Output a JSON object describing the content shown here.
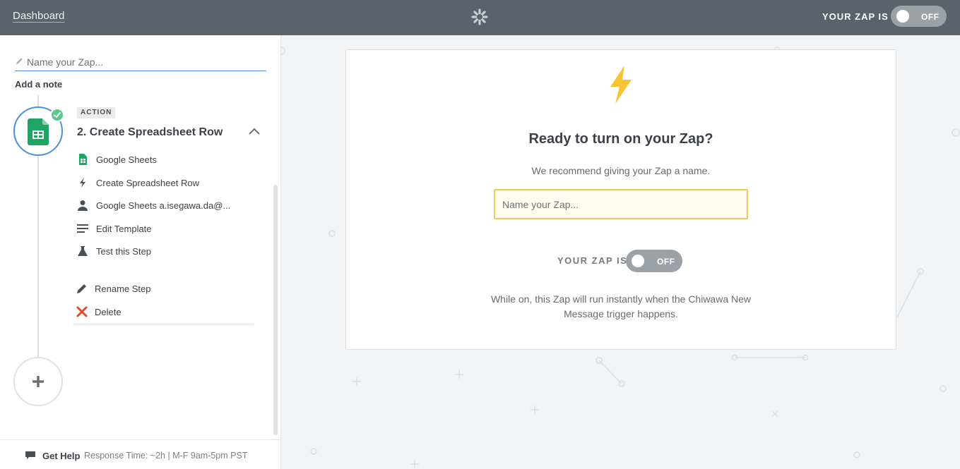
{
  "topbar": {
    "dashboard_label": "Dashboard",
    "zap_status_label": "YOUR ZAP IS",
    "toggle_state": "OFF"
  },
  "sidebar": {
    "zap_name_placeholder": "Name your Zap...",
    "add_note_label": "Add a note",
    "step": {
      "badge": "ACTION",
      "title": "2. Create Spreadsheet Row",
      "app_icon": "google-sheets-icon",
      "status": "complete"
    },
    "menu": [
      {
        "label": "Google Sheets",
        "icon": "google-sheets-icon"
      },
      {
        "label": "Create Spreadsheet Row",
        "icon": "bolt-icon"
      },
      {
        "label": "Google Sheets a.isegawa.da@...",
        "icon": "user-icon"
      },
      {
        "label": "Edit Template",
        "icon": "lines-icon"
      },
      {
        "label": "Test this Step",
        "icon": "flask-icon"
      },
      {
        "label": "Rename Step",
        "icon": "pencil-icon"
      },
      {
        "label": "Delete",
        "icon": "close-icon"
      }
    ],
    "footer": {
      "help_label": "Get Help",
      "response_text": "Response Time: ~2h | M-F 9am-5pm PST"
    }
  },
  "card": {
    "title": "Ready to turn on your Zap?",
    "subtitle": "We recommend giving your Zap a name.",
    "name_placeholder": "Name your Zap...",
    "zap_status_label": "YOUR ZAP IS",
    "toggle_state": "OFF",
    "description": "While on, this Zap will run instantly when the Chiwawa New Message trigger happens."
  },
  "colors": {
    "topbar": "#5b6269",
    "accent_blue": "#4a90d9",
    "bolt_yellow": "#f8c433",
    "sheets_green": "#1fa463",
    "check_green": "#5ac88c",
    "delete_red": "#e8472a",
    "input_highlight": "#f3c94d"
  }
}
